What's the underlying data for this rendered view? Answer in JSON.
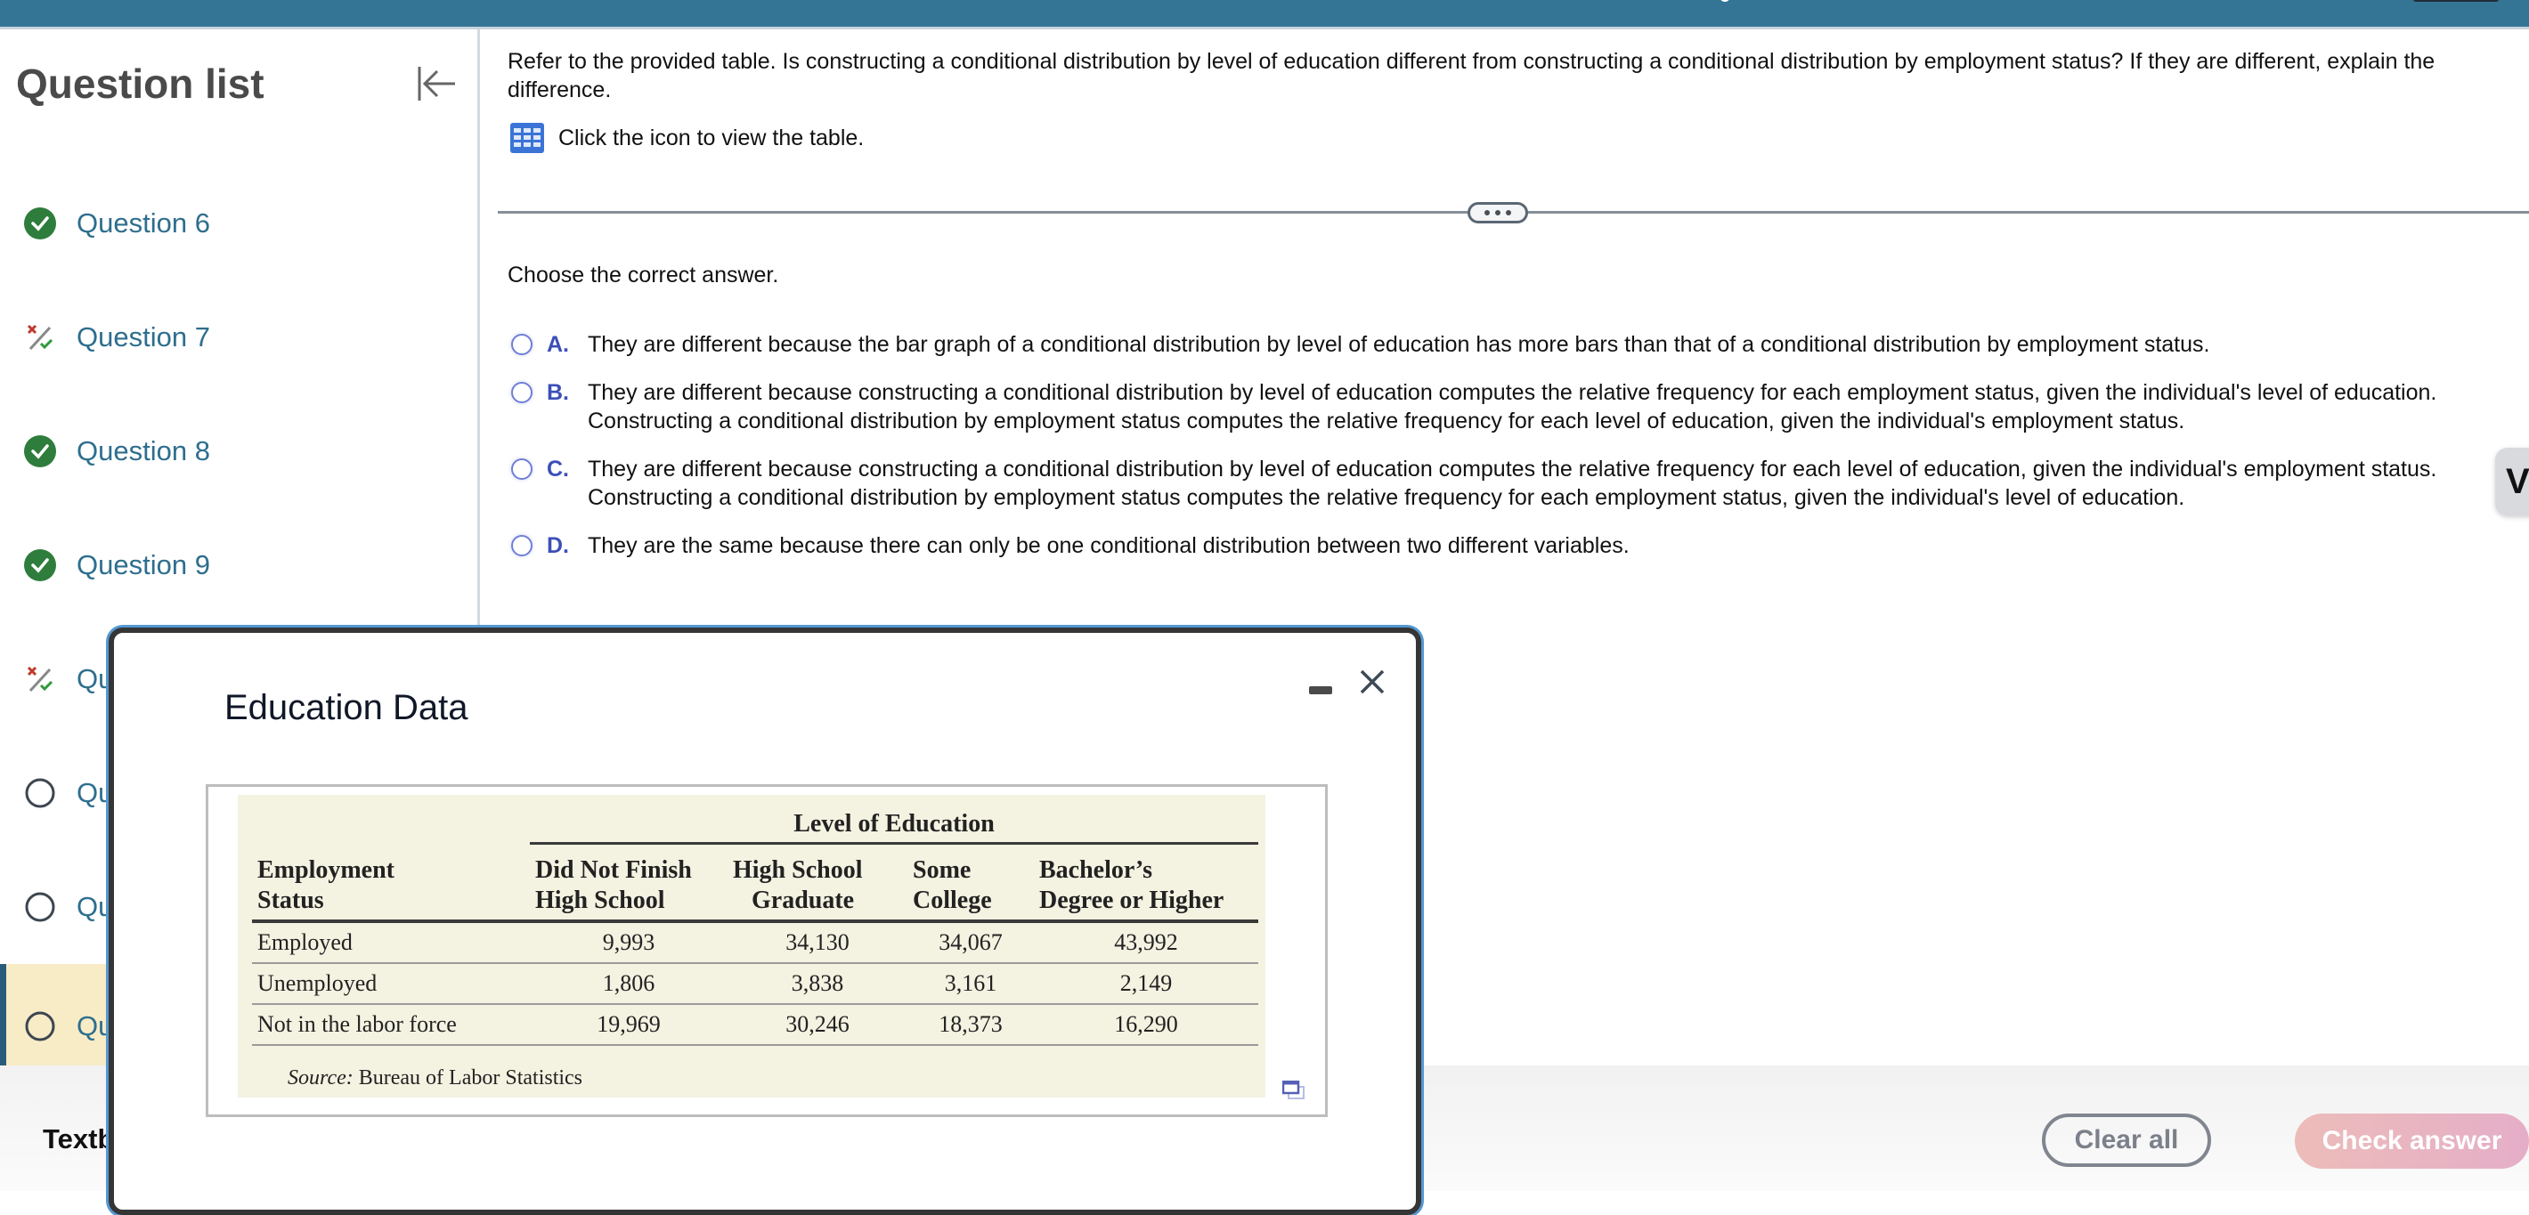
{
  "sidebar": {
    "title": "Question list",
    "collapse_icon": "collapse-left-icon",
    "items": [
      {
        "label": "Question 6",
        "status": "correct",
        "icon": "check-circle-icon"
      },
      {
        "label": "Question 7",
        "status": "partially-correct",
        "icon": "partial-credit-icon"
      },
      {
        "label": "Question 8",
        "status": "correct",
        "icon": "check-circle-icon"
      },
      {
        "label": "Question 9",
        "status": "correct",
        "icon": "check-circle-icon"
      },
      {
        "label": "Qu",
        "status": "partially-correct",
        "icon": "partial-credit-icon"
      },
      {
        "label": "Qu",
        "status": "unanswered",
        "icon": "empty-circle-icon"
      },
      {
        "label": "Qu",
        "status": "unanswered",
        "icon": "empty-circle-icon"
      },
      {
        "label": "Qu",
        "status": "unanswered-current",
        "icon": "empty-circle-icon"
      }
    ],
    "footer_label": "Textb"
  },
  "question": {
    "prompt": "Refer to the provided table. Is constructing a conditional distribution by level of education different from constructing a conditional distribution by employment status? If they are different, explain the difference.",
    "table_link_text": "Click the icon to view the table.",
    "table_icon": "table-grid-icon",
    "instruction": "Choose the correct answer.",
    "options": [
      {
        "letter": "A.",
        "text": "They are different because the bar graph of a conditional distribution by level of education has more bars than that of a conditional distribution by employment status."
      },
      {
        "letter": "B.",
        "text": "They are different because constructing a conditional distribution by level of education computes the relative frequency for each employment status, given the individual's level of education.\nConstructing a conditional distribution by employment status computes the relative frequency for each level of education, given the individual's employment status."
      },
      {
        "letter": "C.",
        "text": "They are different because constructing a conditional distribution by level of education computes the relative frequency for each level of education, given the individual's employment status.\nConstructing a conditional distribution by employment status computes the relative frequency for each employment status, given the individual's level of education."
      },
      {
        "letter": "D.",
        "text": "They are the same because there can only be one conditional distribution between two different variables."
      }
    ],
    "selected": null
  },
  "side_tab_label": "V",
  "footer": {
    "clear_label": "Clear all",
    "check_label": "Check answer"
  },
  "modal": {
    "title": "Education Data",
    "table": {
      "group_header": "Level of Education",
      "row_header": [
        "Employment",
        "Status"
      ],
      "columns": [
        [
          "Did Not Finish",
          "High School"
        ],
        [
          "High School",
          "Graduate"
        ],
        [
          "Some",
          "College"
        ],
        [
          "Bachelor’s",
          "Degree or Higher"
        ]
      ],
      "rows": [
        {
          "label": "Employed",
          "values": [
            "9,993",
            "34,130",
            "34,067",
            "43,992"
          ]
        },
        {
          "label": "Unemployed",
          "values": [
            "1,806",
            "3,838",
            "3,161",
            "2,149"
          ]
        },
        {
          "label": "Not in the labor force",
          "values": [
            "19,969",
            "30,246",
            "18,373",
            "16,290"
          ]
        }
      ],
      "source_label": "Source:",
      "source_text": " Bureau of Labor Statistics"
    }
  },
  "colors": {
    "topbar": "#347596",
    "link": "#2e6e8e",
    "correct": "#2f7d3c",
    "option_letter": "#3c4fb8",
    "current_row": "#f7ecc6",
    "table_bg": "#f4f2e1"
  }
}
